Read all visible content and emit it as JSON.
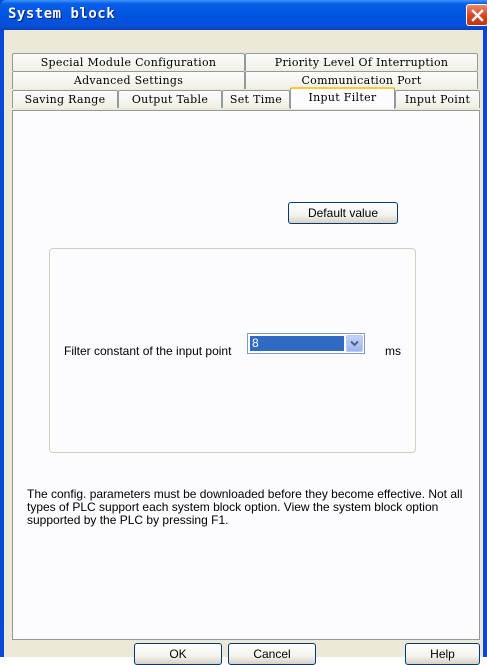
{
  "window": {
    "title": "System block"
  },
  "tabs": [
    {
      "label": "Special Module Configuration",
      "row": 1
    },
    {
      "label": "Priority Level Of Interruption",
      "row": 1
    },
    {
      "label": "Advanced Settings",
      "row": 2
    },
    {
      "label": "Communication Port",
      "row": 2
    },
    {
      "label": "Saving Range",
      "row": 3
    },
    {
      "label": "Output Table",
      "row": 3
    },
    {
      "label": "Set Time",
      "row": 3
    },
    {
      "label": "Input Filter",
      "row": 3,
      "active": true
    },
    {
      "label": "Input Point",
      "row": 3
    }
  ],
  "panel": {
    "default_button": "Default value",
    "filter_label": "Filter constant of the input point",
    "filter_value": "8",
    "unit": "ms",
    "info": "The config. parameters must be downloaded before they become effective. Not all types of PLC support each system block option. View the system block option supported by the PLC by pressing F1."
  },
  "buttons": {
    "ok": "OK",
    "cancel": "Cancel",
    "help": "Help"
  },
  "colors": {
    "title_bar": "#0055e3",
    "selection": "#316ac5",
    "active_tab_highlight": "#ffc73c",
    "close_button": "#d6451f"
  }
}
